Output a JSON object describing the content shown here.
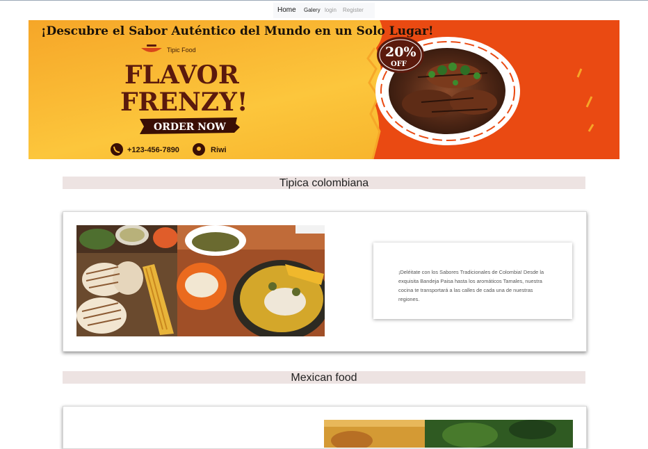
{
  "nav": {
    "items": [
      {
        "label": "Home"
      },
      {
        "label": "Galery"
      },
      {
        "label": "login"
      },
      {
        "label": "Register"
      }
    ]
  },
  "banner": {
    "headline": "¡Descubre el Sabor Auténtico del Mundo en un Solo Lugar!",
    "brand": "Tipic Food",
    "title_line1": "FLAVOR",
    "title_line2": "FRENZY!",
    "order_button": "ORDER NOW",
    "phone": "+123-456-7890",
    "location": "Riwi",
    "discount_pct": "20%",
    "discount_off": "OFF",
    "colors": {
      "yellow": "#f7b52a",
      "orange": "#ea4a12",
      "dark": "#5b1a0d"
    }
  },
  "sections": [
    {
      "title": "Tipica colombiana",
      "description": "¡Deléitate con los Sabores Tradicionales de Colombia! Desde la exquisita Bandeja Paisa hasta los aromáticos Tamales, nuestra cocina te transportará a las calles de cada una de nuestras regiones."
    },
    {
      "title": "Mexican food"
    }
  ]
}
